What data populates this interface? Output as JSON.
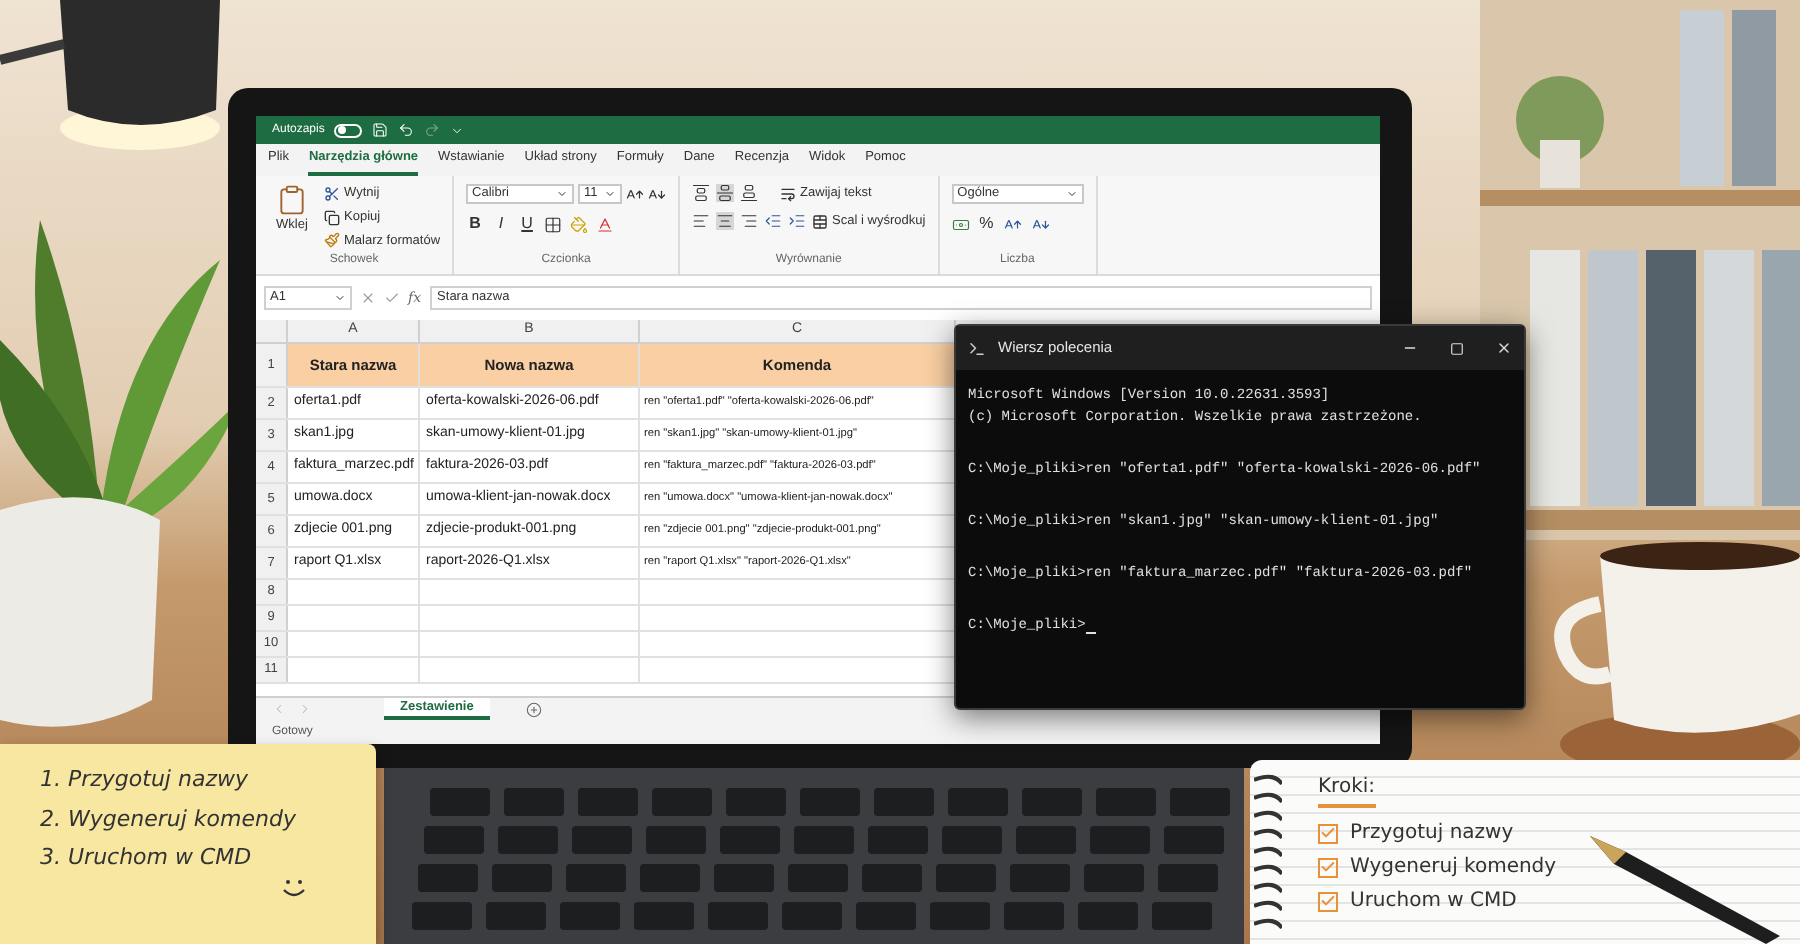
{
  "excel": {
    "autosave": {
      "label": "Autozapis",
      "on": false
    },
    "menu_tabs": [
      {
        "label": "Plik",
        "selected": false
      },
      {
        "label": "Narzędzia główne",
        "selected": true
      },
      {
        "label": "Wstawianie",
        "selected": false
      },
      {
        "label": "Układ strony",
        "selected": false
      },
      {
        "label": "Formuły",
        "selected": false
      },
      {
        "label": "Dane",
        "selected": false
      },
      {
        "label": "Recenzja",
        "selected": false
      },
      {
        "label": "Widok",
        "selected": false
      },
      {
        "label": "Pomoc",
        "selected": false
      }
    ],
    "ribbon": [
      {
        "kind": "clipboard",
        "label": "Schowek",
        "paste": "Wklej",
        "cut": "Wytnij",
        "copy": "Kopiuj",
        "painter": "Malarz formatów"
      },
      {
        "kind": "font",
        "label": "Czcionka",
        "font": "Calibri",
        "size": "11",
        "bold": "B",
        "italic": "I",
        "underline": "U"
      },
      {
        "kind": "alignment",
        "label": "Wyrównanie",
        "wrap": "Zawijaj tekst",
        "merge": "Scal i wyśrodkuj"
      },
      {
        "kind": "number",
        "label": "Liczba",
        "format": "Ogólne",
        "percent": "%"
      }
    ],
    "name_box": "A1",
    "function_label": "fx",
    "formula": "Stara nazwa",
    "columns": [
      "A",
      "B",
      "C"
    ],
    "rows": [
      {
        "number": "1",
        "header": true,
        "cells": [
          "Stara nazwa",
          "Nowa nazwa",
          "Komenda"
        ]
      },
      {
        "number": "2",
        "header": false,
        "cells": [
          "oferta1.pdf",
          "oferta-kowalski-2026-06.pdf",
          "ren \"oferta1.pdf\" \"oferta-kowalski-2026-06.pdf\""
        ]
      },
      {
        "number": "3",
        "header": false,
        "cells": [
          "skan1.jpg",
          "skan-umowy-klient-01.jpg",
          "ren \"skan1.jpg\" \"skan-umowy-klient-01.jpg\""
        ]
      },
      {
        "number": "4",
        "header": false,
        "cells": [
          "faktura_marzec.pdf",
          "faktura-2026-03.pdf",
          "ren \"faktura_marzec.pdf\" \"faktura-2026-03.pdf\""
        ]
      },
      {
        "number": "5",
        "header": false,
        "cells": [
          "umowa.docx",
          "umowa-klient-jan-nowak.docx",
          "ren \"umowa.docx\" \"umowa-klient-jan-nowak.docx\""
        ]
      },
      {
        "number": "6",
        "header": false,
        "cells": [
          "zdjecie 001.png",
          "zdjecie-produkt-001.png",
          "ren \"zdjecie 001.png\" \"zdjecie-produkt-001.png\""
        ]
      },
      {
        "number": "7",
        "header": false,
        "cells": [
          "raport Q1.xlsx",
          "raport-2026-Q1.xlsx",
          "ren \"raport Q1.xlsx\" \"raport-2026-Q1.xlsx\""
        ]
      },
      {
        "number": "8",
        "header": false,
        "cells": []
      },
      {
        "number": "9",
        "header": false,
        "cells": []
      },
      {
        "number": "10",
        "header": false,
        "cells": []
      },
      {
        "number": "11",
        "header": false,
        "cells": []
      }
    ],
    "sheet_tabs": [
      {
        "label": "Zestawienie",
        "selected": true
      }
    ],
    "status": "Gotowy"
  },
  "cmd": {
    "title": "Wiersz polecenia",
    "lines": [
      {
        "kind": "output",
        "text": "Microsoft Windows [Version 10.0.22631.3593]"
      },
      {
        "kind": "output",
        "text": "(c) Microsoft Corporation. Wszelkie prawa zastrzeżone."
      },
      {
        "kind": "command",
        "text": "C:\\Moje_pliki>ren \"oferta1.pdf\" \"oferta-kowalski-2026-06.pdf\""
      },
      {
        "kind": "command",
        "text": "C:\\Moje_pliki>ren \"skan1.jpg\" \"skan-umowy-klient-01.jpg\""
      },
      {
        "kind": "command",
        "text": "C:\\Moje_pliki>ren \"faktura_marzec.pdf\" \"faktura-2026-03.pdf\""
      },
      {
        "kind": "prompt",
        "text": "C:\\Moje_pliki>"
      }
    ]
  },
  "sticky_note": {
    "items": [
      "1. Przygotuj nazwy",
      "2. Wygeneruj komendy",
      "3. Uruchom w CMD"
    ]
  },
  "notebook": {
    "title": "Kroki:",
    "items": [
      {
        "label": "Przygotuj nazwy",
        "checked": true
      },
      {
        "label": "Wygeneruj komendy",
        "checked": true
      },
      {
        "label": "Uruchom w CMD",
        "checked": true
      }
    ]
  }
}
